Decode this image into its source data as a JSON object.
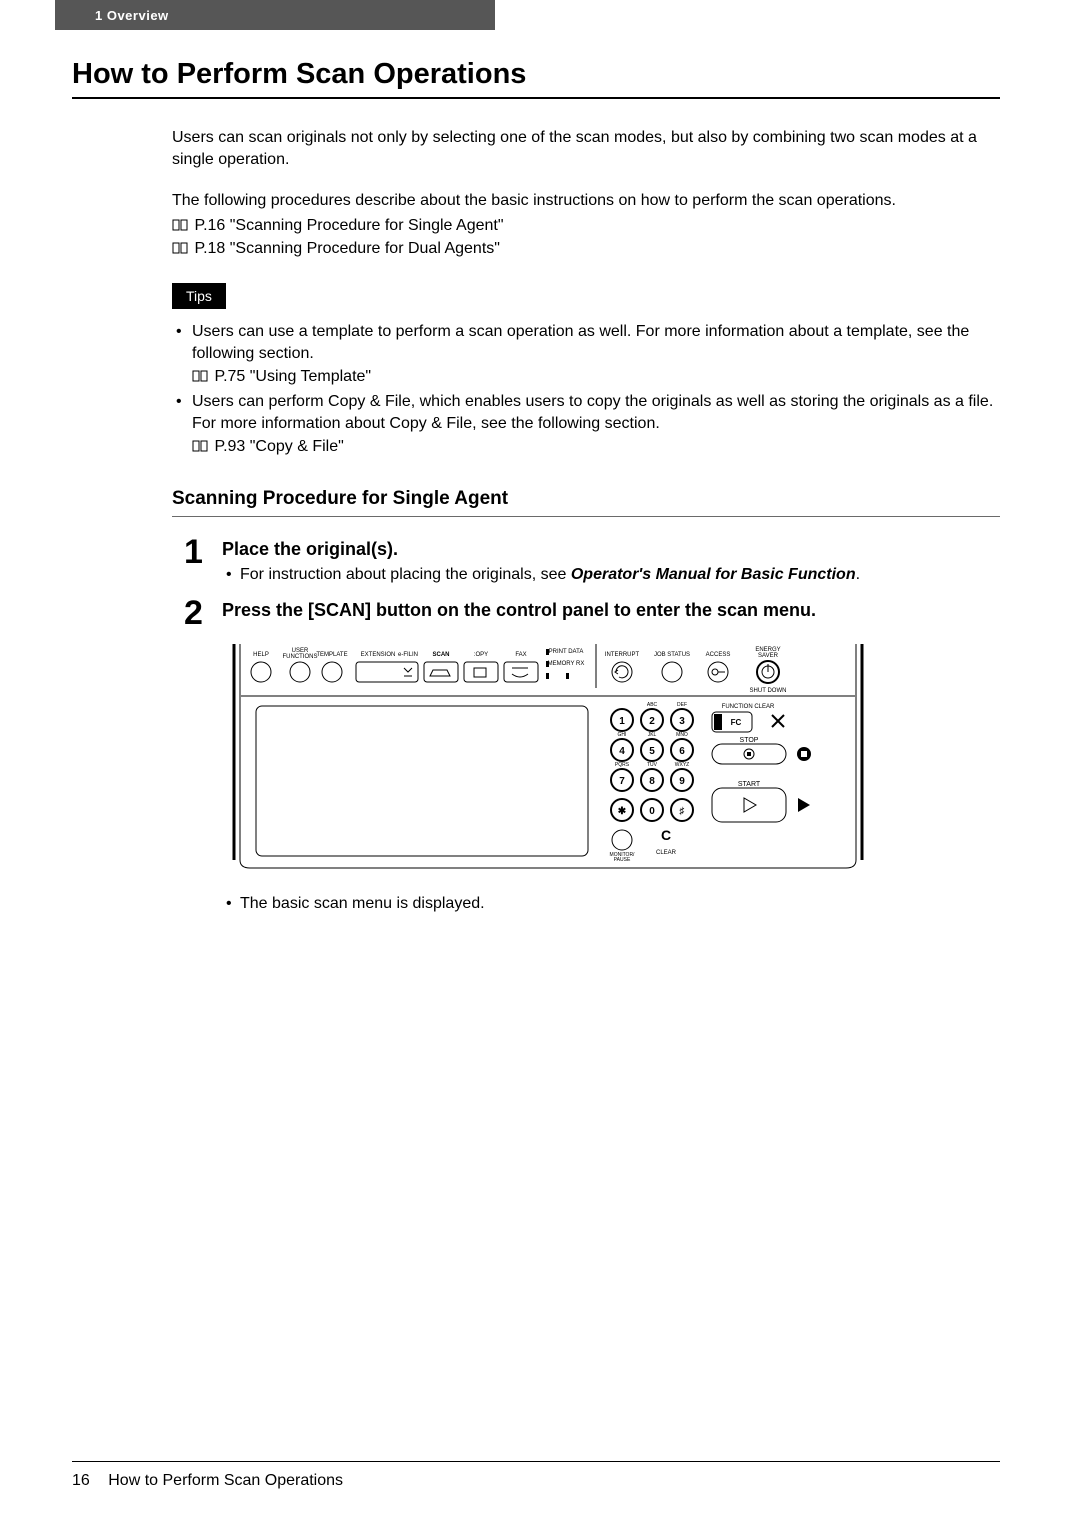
{
  "header": {
    "chapter": "1",
    "chapter_title": "Overview",
    "tab_text": "1  Overview"
  },
  "title": "How to Perform Scan Operations",
  "intro1": "Users can scan originals not only by selecting one of the scan modes, but also by combining two scan modes at a single operation.",
  "intro2": "The following procedures describe about the basic instructions on how to perform the scan operations.",
  "xref1": "P.16 \"Scanning Procedure for Single Agent\"",
  "xref2": "P.18 \"Scanning Procedure for Dual Agents\"",
  "tips_label": "Tips",
  "tip1": "Users can use a template to perform a scan operation as well.  For more information about a template, see the following section.",
  "tip1_xref": "P.75 \"Using Template\"",
  "tip2": "Users can perform Copy & File, which enables users to copy the originals as well as storing the originals as a file.  For more information about Copy & File, see the following section.",
  "tip2_xref": "P.93 \"Copy & File\"",
  "section_h2": "Scanning Procedure for Single Agent",
  "steps": {
    "s1": {
      "num": "1",
      "title": "Place the original(s).",
      "sub": "For instruction about placing the originals, see ",
      "sub_em": "Operator's Manual for Basic Function",
      "sub_tail": "."
    },
    "s2": {
      "num": "2",
      "title": "Press the [SCAN] button on the control panel to enter the scan menu.",
      "after": "The basic scan menu is displayed."
    }
  },
  "panel": {
    "top_labels": [
      "HELP",
      "USER FUNCTIONS",
      "TEMPLATE",
      "EXTENSION",
      "e-FILIN",
      "SCAN",
      "COPY",
      "FAX",
      "PRINT DATA",
      "MEMORY RX",
      "INTERRUPT",
      "JOB STATUS",
      "ACCESS",
      "ENERGY SAVER"
    ],
    "shutdown": "SHUT DOWN",
    "keypad": [
      "1",
      "2",
      "3",
      "4",
      "5",
      "6",
      "7",
      "8",
      "9",
      "✱",
      "0",
      "♯"
    ],
    "letters": [
      "ABC",
      "DEF",
      "GHI",
      "JKL",
      "MNO",
      "PQRS",
      "TUV",
      "WXYZ"
    ],
    "right_buttons": {
      "function_clear": "FUNCTION CLEAR",
      "fc": "FC",
      "stop": "STOP",
      "start": "START"
    },
    "bottom": {
      "monitor": "MONITOR/ PAUSE",
      "clear": "CLEAR",
      "c": "C"
    }
  },
  "footer": {
    "page": "16",
    "title": "How to Perform Scan Operations"
  }
}
